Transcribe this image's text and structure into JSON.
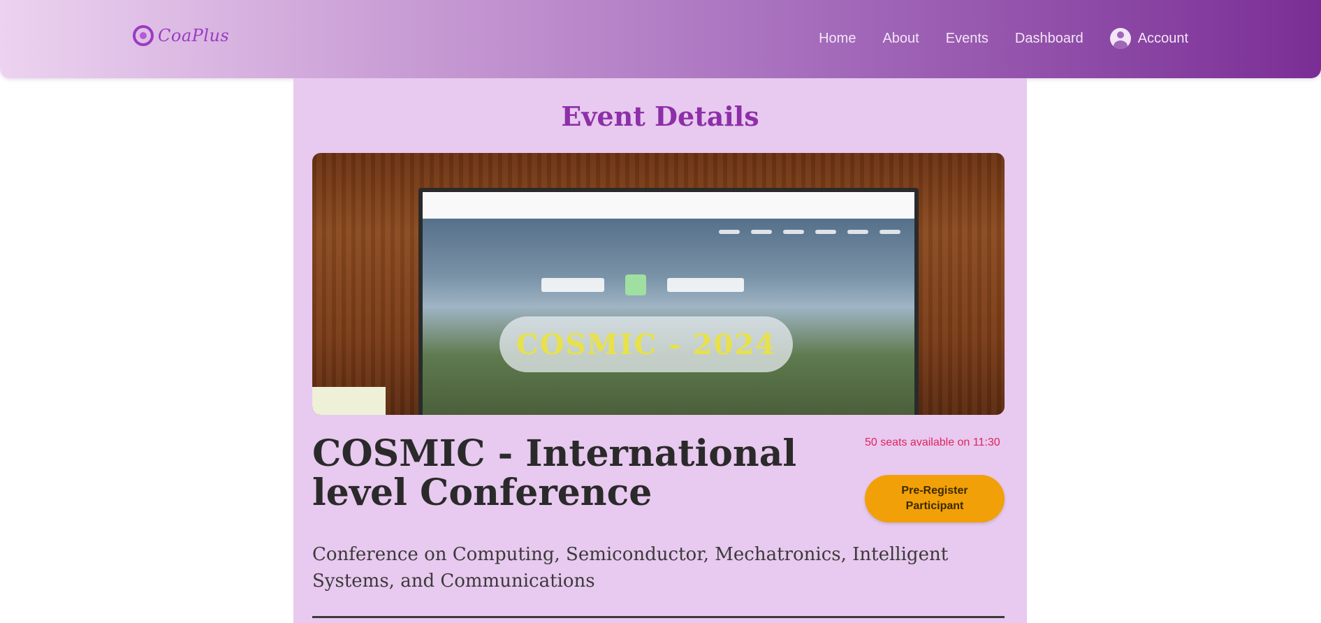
{
  "navbar": {
    "logo_text": "CoaPlus",
    "links": [
      {
        "label": "Home"
      },
      {
        "label": "About"
      },
      {
        "label": "Events"
      },
      {
        "label": "Dashboard"
      }
    ],
    "account_label": "Account"
  },
  "main": {
    "section_title": "Event Details",
    "hero_image": {
      "banner_text": "COSMIC - 2024"
    },
    "event": {
      "title": "COSMIC - International level Conference",
      "seats_available": "50 seats available on 11:30",
      "register_label": "Pre-Register Participant",
      "subtitle": "Conference on Computing, Semiconductor, Mechatronics, Intelligent Systems, and Communications"
    }
  },
  "colors": {
    "nav_gradient_start": "#ecd3f0",
    "nav_gradient_end": "#7a2e95",
    "panel_bg": "#e8c9ef",
    "title_purple": "#8d2fa8",
    "seats_red": "#e0245e",
    "button_orange": "#f2a007"
  }
}
